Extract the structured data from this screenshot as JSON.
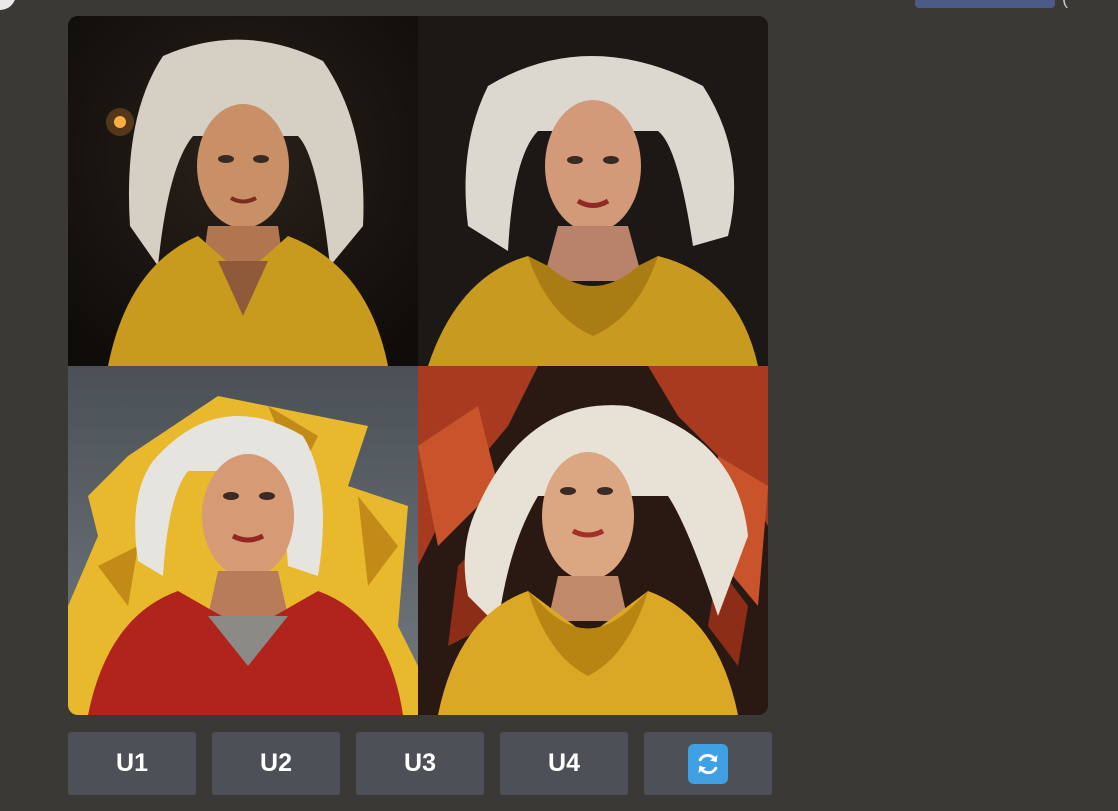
{
  "message": {
    "link_text": "",
    "grid_images": [
      {
        "icon": "portrait-image",
        "description_name": "portrait-1"
      },
      {
        "icon": "portrait-image",
        "description_name": "portrait-2"
      },
      {
        "icon": "portrait-image",
        "description_name": "portrait-3"
      },
      {
        "icon": "portrait-image",
        "description_name": "portrait-4"
      }
    ]
  },
  "buttons": {
    "u1": "U1",
    "u2": "U2",
    "u3": "U3",
    "u4": "U4",
    "reroll_icon": "refresh-icon"
  },
  "colors": {
    "background": "#3b3935",
    "button": "#4e5058",
    "reroll_accent": "#3fa0e3"
  }
}
